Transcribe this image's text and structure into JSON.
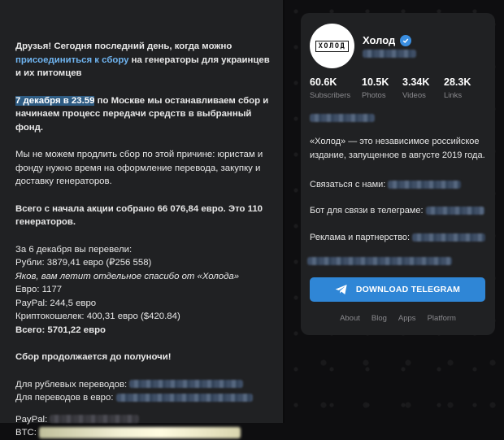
{
  "message": {
    "p1_start": "Друзья! Сегодня последний день, когда можно",
    "p1_link": "присоединиться к сбору",
    "p1_end": "на генераторы для украинцев и их питомцев",
    "p2_highlight": "7 декабря в 23.59",
    "p2_rest": "по Москве мы останавливаем сбор и начинаем процесс передачи средств в выбранный фонд.",
    "p3": "Мы не можем продлить сбор по этой причине: юристам и фонду нужно время на оформление перевода, закупку и доставку генераторов.",
    "p4": "Всего с начала акции собрано 66 076,84 евро. Это 110 генераторов.",
    "list_title": "За 6 декабря вы перевели:",
    "rubles": "Рубли: 3879,41 евро (₽256 558)",
    "thanks": "Яков, вам летит отдельное спасибо от «Холода»",
    "euro": "Евро: 1177",
    "paypal_amount": "PayPal: 244,5 евро",
    "crypto": "Криптокошелек: 400,31 евро ($420.84)",
    "total": "Всего: 5701,22 евро",
    "continues": "Сбор продолжается до полуночи!",
    "rub_transfers": "Для рублевых переводов:",
    "eur_transfers": "Для переводов в евро:",
    "paypal_label": "PayPal:",
    "btc_label": "BTC:"
  },
  "channel": {
    "logo_text": "ХОЛОД",
    "name": "Холод",
    "stats": [
      {
        "num": "60.6K",
        "label": "Subscribers"
      },
      {
        "num": "10.5K",
        "label": "Photos"
      },
      {
        "num": "3.34K",
        "label": "Videos"
      },
      {
        "num": "28.3K",
        "label": "Links"
      }
    ],
    "description": "«Холод» — это независимое российское издание, запущенное в августе 2019 года.",
    "contact": "Связаться с нами:",
    "bot": "Бот для связи в телеграме:",
    "ads": "Реклама и партнерство:",
    "download_label": "DOWNLOAD TELEGRAM",
    "footer": [
      "About",
      "Blog",
      "Apps",
      "Platform"
    ]
  },
  "colors": {
    "accent": "#2f86d6",
    "link": "#6fb4f0",
    "highlight": "#2e5c83",
    "panel": "#202123",
    "background": "#0e0e10"
  }
}
